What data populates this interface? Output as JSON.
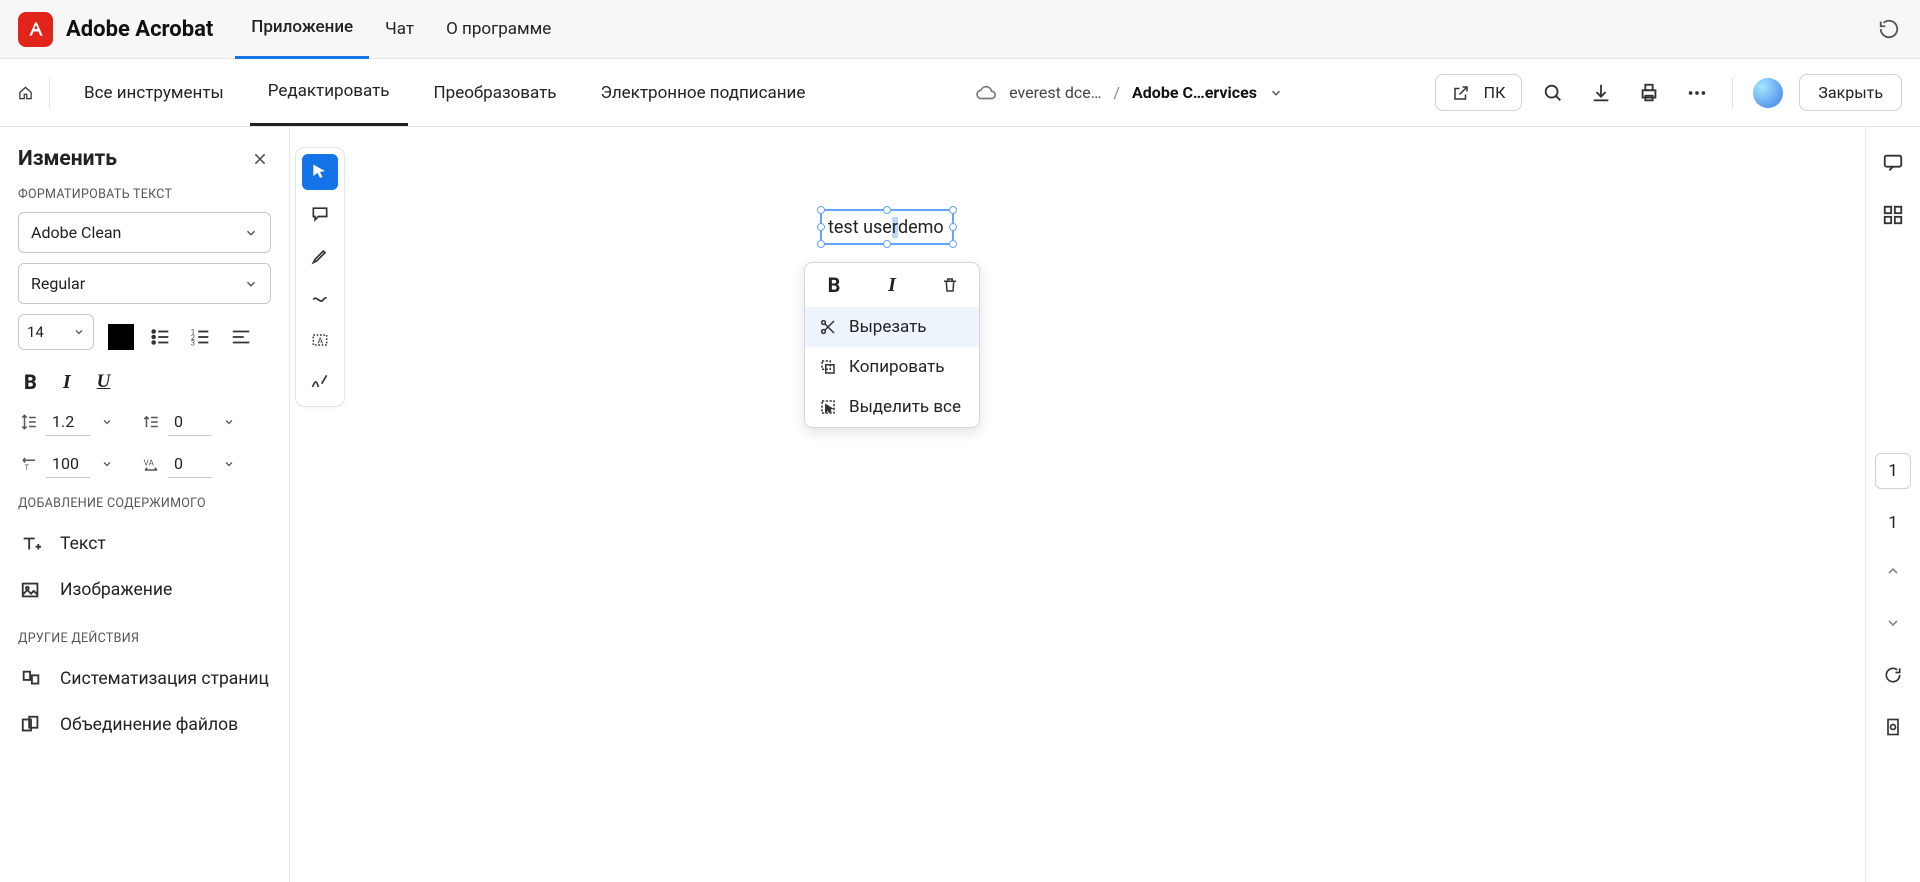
{
  "top": {
    "brand": "Adobe Acrobat",
    "tabs": [
      "Приложение",
      "Чат",
      "О программе"
    ],
    "active_tab": 0
  },
  "secondbar": {
    "tabs": [
      "Все инструменты",
      "Редактировать",
      "Преобразовать",
      "Электронное подписание"
    ],
    "active_tab": 1,
    "crumb_space": "everest dce…",
    "crumb_sep": "/",
    "crumb_doc": "Adobe C…ervices",
    "pk_label": "ПК",
    "close_label": "Закрыть"
  },
  "sidepanel": {
    "title": "Изменить",
    "section_format": "ФОРМАТИРОВАТЬ ТЕКСТ",
    "font_family": "Adobe Clean",
    "font_style": "Regular",
    "font_size": "14",
    "line_height": "1.2",
    "char_spacing": "0",
    "horiz_scale": "100",
    "kerning": "0",
    "section_add": "ДОБАВЛЕНИЕ СОДЕРЖИМОГО",
    "add_text": "Текст",
    "add_image": "Изображение",
    "section_other": "ДРУГИЕ ДЕЙСТВИЯ",
    "organize_pages": "Систематизация страниц",
    "combine_files": "Объединение файлов"
  },
  "canvas": {
    "text_content": "test user demo",
    "page_current": "1",
    "page_total": "1"
  },
  "context_menu": {
    "cut": "Вырезать",
    "copy": "Копировать",
    "select_all": "Выделить все"
  }
}
